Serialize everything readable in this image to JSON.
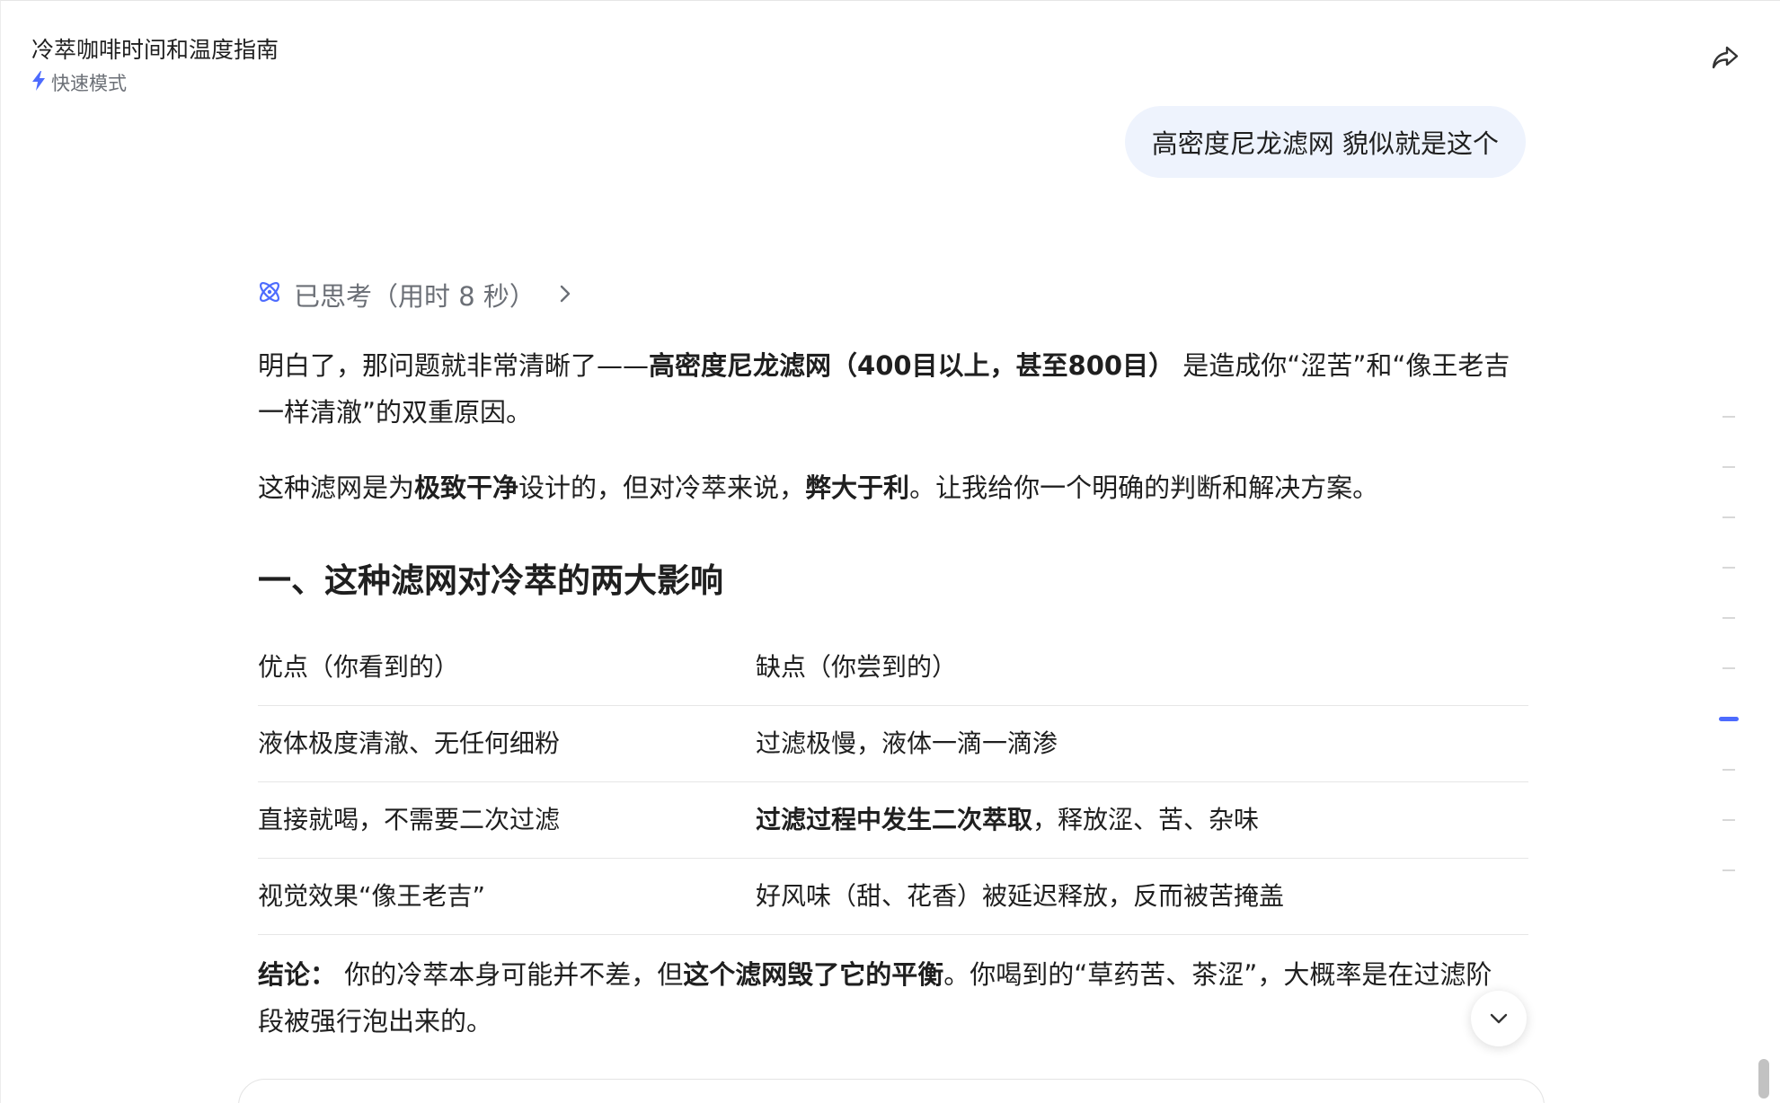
{
  "header": {
    "title": "冷萃咖啡时间和温度指南",
    "mode_label": "快速模式",
    "mode_icon": "lightning-icon",
    "share_icon": "share-icon"
  },
  "user_message": "高密度尼龙滤网 貌似就是这个",
  "thought": {
    "label": "已思考（用时 8 秒）",
    "icon": "atom-icon"
  },
  "answer": {
    "p1": {
      "a": "明白了，那问题就非常清晰了——",
      "b": "高密度尼龙滤网（400目以上，甚至800目）",
      "c": " 是造成你“涩苦”和“像王老吉一样清澈”的双重原因。"
    },
    "p2": {
      "a": "这种滤网是为",
      "b": "极致干净",
      "c": "设计的，但对冷萃来说，",
      "d": "弊大于利",
      "e": "。让我给你一个明确的判断和解决方案。"
    },
    "section_title": "一、这种滤网对冷萃的两大影响",
    "table": {
      "headers": [
        "优点（你看到的）",
        "缺点（你尝到的）"
      ],
      "rows": [
        {
          "pro": "液体极度清澈、无任何细粉",
          "con_bold": "",
          "con": "过滤极慢，液体一滴一滴渗"
        },
        {
          "pro": "直接就喝，不需要二次过滤",
          "con_bold": "过滤过程中发生二次萃取",
          "con": "，释放涩、苦、杂味"
        },
        {
          "pro": "视觉效果“像王老吉”",
          "con_bold": "",
          "con": "好风味（甜、花香）被延迟释放，反而被苦掩盖"
        }
      ]
    },
    "conclusion": {
      "label": "结论：",
      "a": " 你的冷萃本身可能并不差，但",
      "b": "这个滤网毁了它的平衡",
      "c": "。你喝到的“草药苦、茶涩”，大概率是在过滤阶段被强行泡出来的。"
    }
  },
  "controls": {
    "scroll_down_icon": "chevron-down-icon"
  },
  "colors": {
    "accent": "#4d6bfe",
    "user_bubble": "#eef3fd",
    "muted_text": "#6b6f76"
  }
}
